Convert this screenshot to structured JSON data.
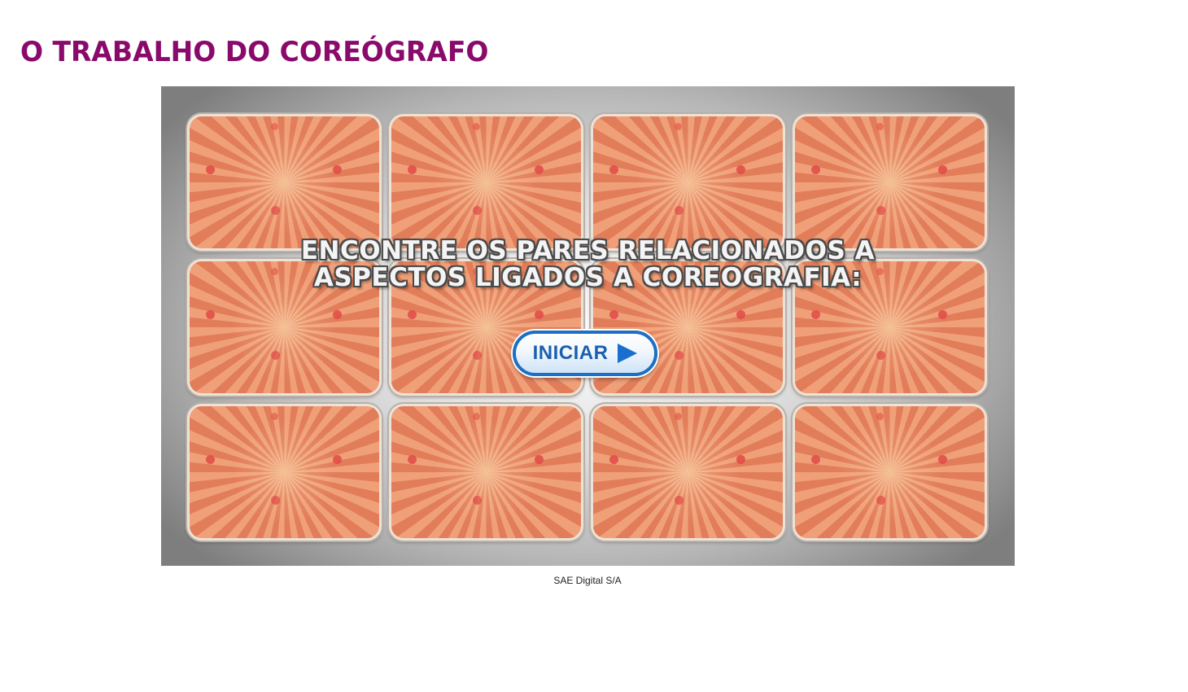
{
  "page": {
    "title": "O TRABALHO DO COREÓGRAFO",
    "footer": "SAE Digital S/A"
  },
  "game": {
    "instruction_line1": "ENCONTRE OS PARES RELACIONADOS A",
    "instruction_line2": "ASPECTOS LIGADOS A COREOGRAFIA:",
    "start_button_label": "INICIAR",
    "start_button_icon": "play-arrow-icon",
    "card_rows": 3,
    "card_columns": 4,
    "cards_face_down": 12
  },
  "colors": {
    "title": "#8a0a6b",
    "card_ray_light": "#f0a078",
    "card_ray_dark": "#e27d5a",
    "button_border": "#1c6fc4",
    "button_text": "#1a5fae"
  }
}
